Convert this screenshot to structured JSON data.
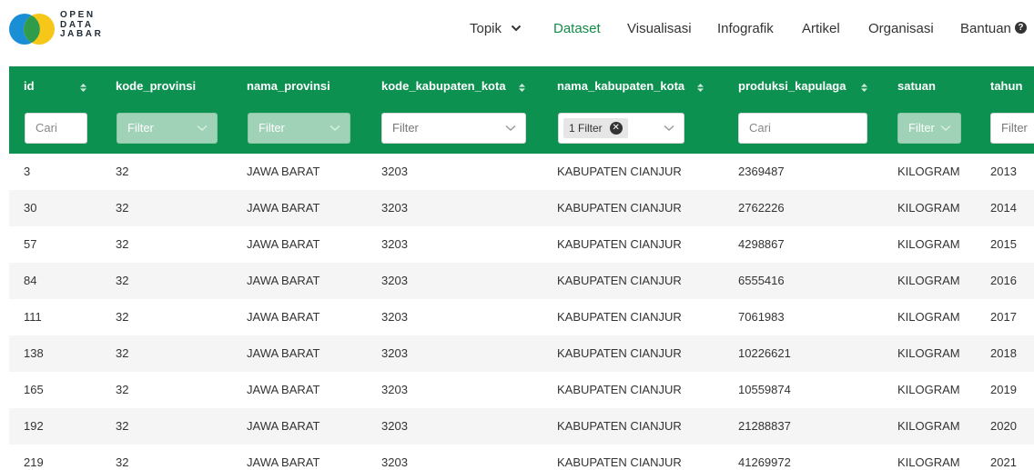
{
  "logo": {
    "line1": "OPEN",
    "line2": "DATA",
    "line3": "JABAR"
  },
  "nav": {
    "topik": "Topik",
    "dataset": "Dataset",
    "visualisasi": "Visualisasi",
    "infografik": "Infografik",
    "artikel": "Artikel",
    "organisasi": "Organisasi",
    "bantuan": "Bantuan"
  },
  "colors": {
    "header_green": "#0d9151",
    "active_nav": "#168a48",
    "logo_blue": "#1a8fd6",
    "logo_yellow": "#f6c619",
    "logo_green": "#2e9c4a"
  },
  "table": {
    "columns": [
      {
        "key": "id",
        "label": "id",
        "sortable": true,
        "filter": {
          "kind": "input",
          "text": "Cari"
        }
      },
      {
        "key": "kode_provinsi",
        "label": "kode_provinsi",
        "sortable": false,
        "filter": {
          "kind": "disabled",
          "text": "Filter"
        }
      },
      {
        "key": "nama_provinsi",
        "label": "nama_provinsi",
        "sortable": false,
        "filter": {
          "kind": "disabled",
          "text": "Filter"
        }
      },
      {
        "key": "kode_kabupaten_kota",
        "label": "kode_kabupaten_kota",
        "sortable": true,
        "filter": {
          "kind": "select",
          "text": "Filter"
        }
      },
      {
        "key": "nama_kabupaten_kota",
        "label": "nama_kabupaten_kota",
        "sortable": true,
        "filter": {
          "kind": "tag",
          "text": "1 Filter"
        }
      },
      {
        "key": "produksi_kapulaga",
        "label": "produksi_kapulaga",
        "sortable": true,
        "filter": {
          "kind": "input",
          "text": "Cari"
        }
      },
      {
        "key": "satuan",
        "label": "satuan",
        "sortable": false,
        "filter": {
          "kind": "disabled",
          "text": "Filter"
        }
      },
      {
        "key": "tahun",
        "label": "tahun",
        "sortable": false,
        "filter": {
          "kind": "select",
          "text": "Filter"
        }
      }
    ],
    "rows": [
      [
        "3",
        "32",
        "JAWA BARAT",
        "3203",
        "KABUPATEN CIANJUR",
        "2369487",
        "KILOGRAM",
        "2013"
      ],
      [
        "30",
        "32",
        "JAWA BARAT",
        "3203",
        "KABUPATEN CIANJUR",
        "2762226",
        "KILOGRAM",
        "2014"
      ],
      [
        "57",
        "32",
        "JAWA BARAT",
        "3203",
        "KABUPATEN CIANJUR",
        "4298867",
        "KILOGRAM",
        "2015"
      ],
      [
        "84",
        "32",
        "JAWA BARAT",
        "3203",
        "KABUPATEN CIANJUR",
        "6555416",
        "KILOGRAM",
        "2016"
      ],
      [
        "111",
        "32",
        "JAWA BARAT",
        "3203",
        "KABUPATEN CIANJUR",
        "7061983",
        "KILOGRAM",
        "2017"
      ],
      [
        "138",
        "32",
        "JAWA BARAT",
        "3203",
        "KABUPATEN CIANJUR",
        "10226621",
        "KILOGRAM",
        "2018"
      ],
      [
        "165",
        "32",
        "JAWA BARAT",
        "3203",
        "KABUPATEN CIANJUR",
        "10559874",
        "KILOGRAM",
        "2019"
      ],
      [
        "192",
        "32",
        "JAWA BARAT",
        "3203",
        "KABUPATEN CIANJUR",
        "21288837",
        "KILOGRAM",
        "2020"
      ],
      [
        "219",
        "32",
        "JAWA BARAT",
        "3203",
        "KABUPATEN CIANJUR",
        "41269972",
        "KILOGRAM",
        "2021"
      ]
    ]
  }
}
